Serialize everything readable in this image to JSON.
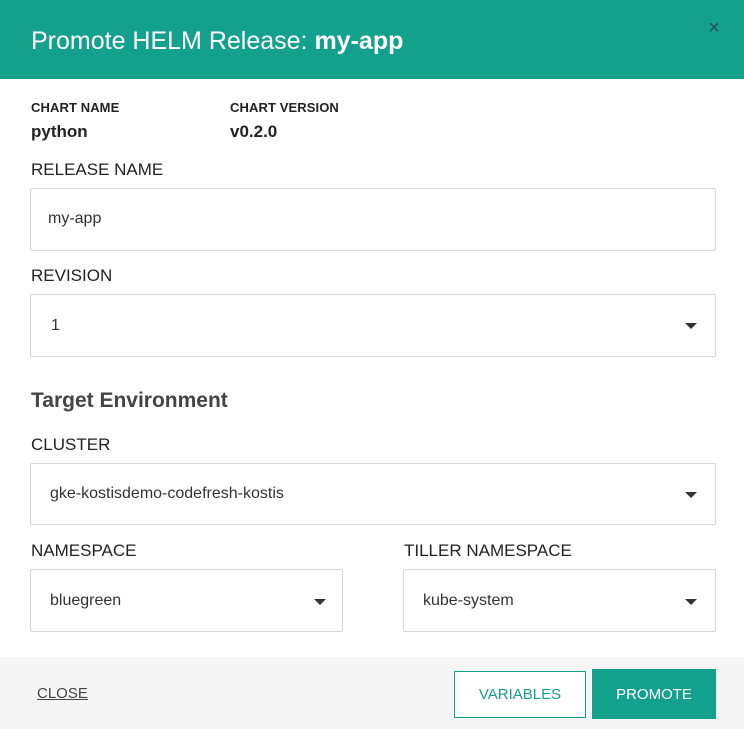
{
  "dialog": {
    "title_prefix": "Promote HELM Release: ",
    "title_name": "my-app",
    "close_icon": "×"
  },
  "chart": {
    "name_label": "CHART NAME",
    "name_value": "python",
    "version_label": "CHART VERSION",
    "version_value": "v0.2.0"
  },
  "release": {
    "label": "RELEASE NAME",
    "value": "my-app"
  },
  "revision": {
    "label": "REVISION",
    "value": "1"
  },
  "target": {
    "heading": "Target Environment",
    "cluster_label": "CLUSTER",
    "cluster_value": "gke-kostisdemo-codefresh-kostis",
    "namespace_label": "NAMESPACE",
    "namespace_value": "bluegreen",
    "tiller_label": "TILLER NAMESPACE",
    "tiller_value": "kube-system"
  },
  "footer": {
    "close_label": "CLOSE",
    "variables_label": "VARIABLES",
    "promote_label": "PROMOTE"
  },
  "colors": {
    "accent": "#13a08d",
    "footer_bg": "#f5f5f5",
    "border": "#d6d6d6"
  }
}
